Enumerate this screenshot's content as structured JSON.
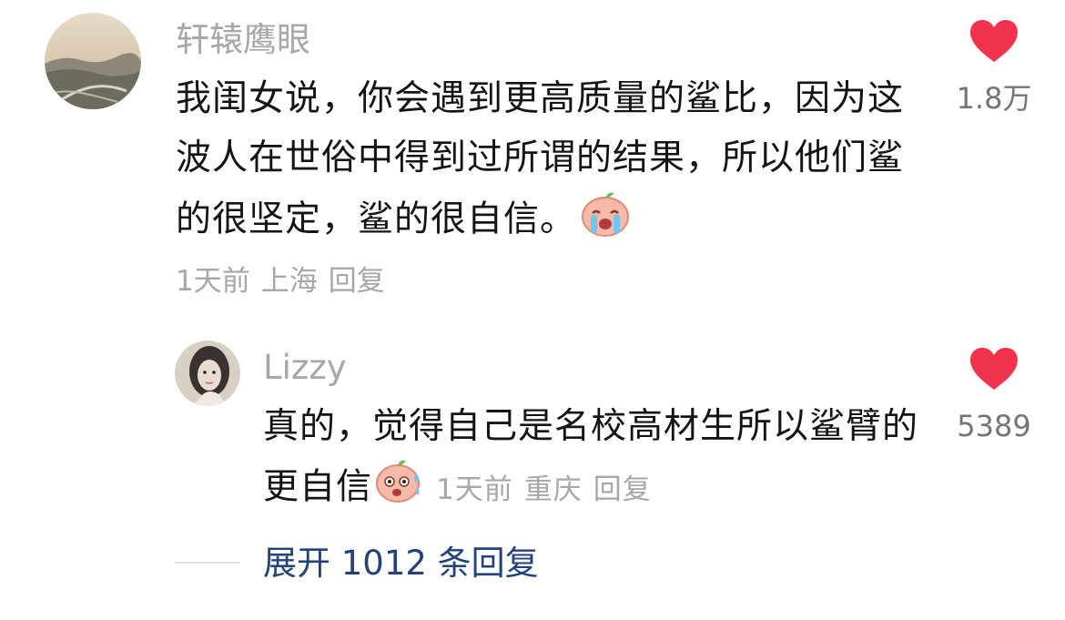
{
  "comment": {
    "username": "轩辕鹰眼",
    "text": "我闺女说，你会遇到更高质量的鲨比，因为这波人在世俗中得到过所谓的结果，所以他们鲨的很坚定，鲨的很自信。",
    "emoji_icon": "crying-face-emoji",
    "time": "1天前",
    "location": "上海",
    "reply_label": "回复",
    "like_count": "1.8万",
    "like_color": "#f0334e"
  },
  "reply": {
    "username": "Lizzy",
    "text": "真的，觉得自己是名校高材生所以鲨臂的更自信",
    "emoji_icon": "sweating-face-emoji",
    "time": "1天前",
    "location": "重庆",
    "reply_label": "回复",
    "like_count": "5389",
    "like_color": "#f0334e"
  },
  "expand": {
    "label": "展开 1012 条回复"
  }
}
